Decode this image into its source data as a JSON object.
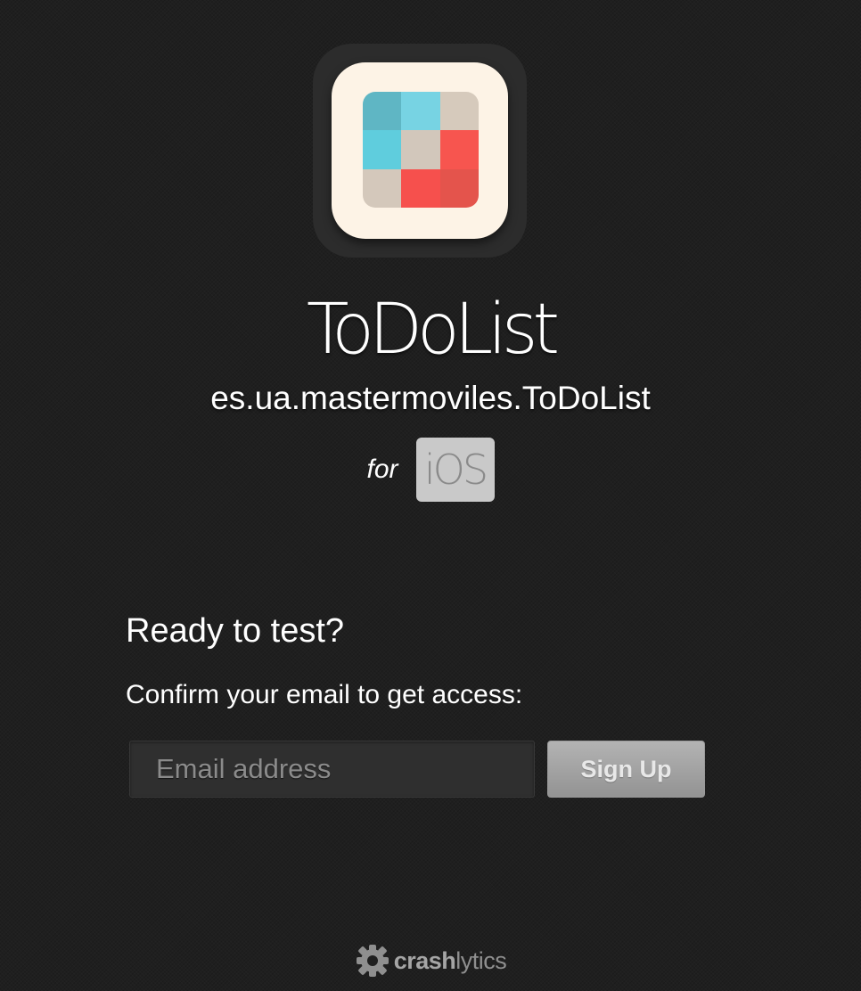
{
  "app": {
    "name": "ToDoList",
    "bundle_id": "es.ua.mastermoviles.ToDoList",
    "icon_name": "app-grid-icon",
    "icon_colors": [
      "#5fb6c4",
      "#77d3e3",
      "#d6cabc",
      "#5fcddd",
      "#d2c7bb",
      "#f7554f",
      "#d4c8bb",
      "#f6504d",
      "#e4544c"
    ]
  },
  "platform": {
    "prefix": "for",
    "name": "iOS"
  },
  "signup": {
    "heading": "Ready to test?",
    "instruction": "Confirm your email to get access:",
    "email_placeholder": "Email address",
    "email_value": "",
    "button_label": "Sign Up"
  },
  "footer": {
    "brand_strong": "crash",
    "brand_light": "lytics",
    "icon_name": "crashlytics-gear-icon"
  },
  "colors": {
    "background": "#1f1f1f",
    "button": "#a3a3a3",
    "input": "#2f2f2f"
  }
}
